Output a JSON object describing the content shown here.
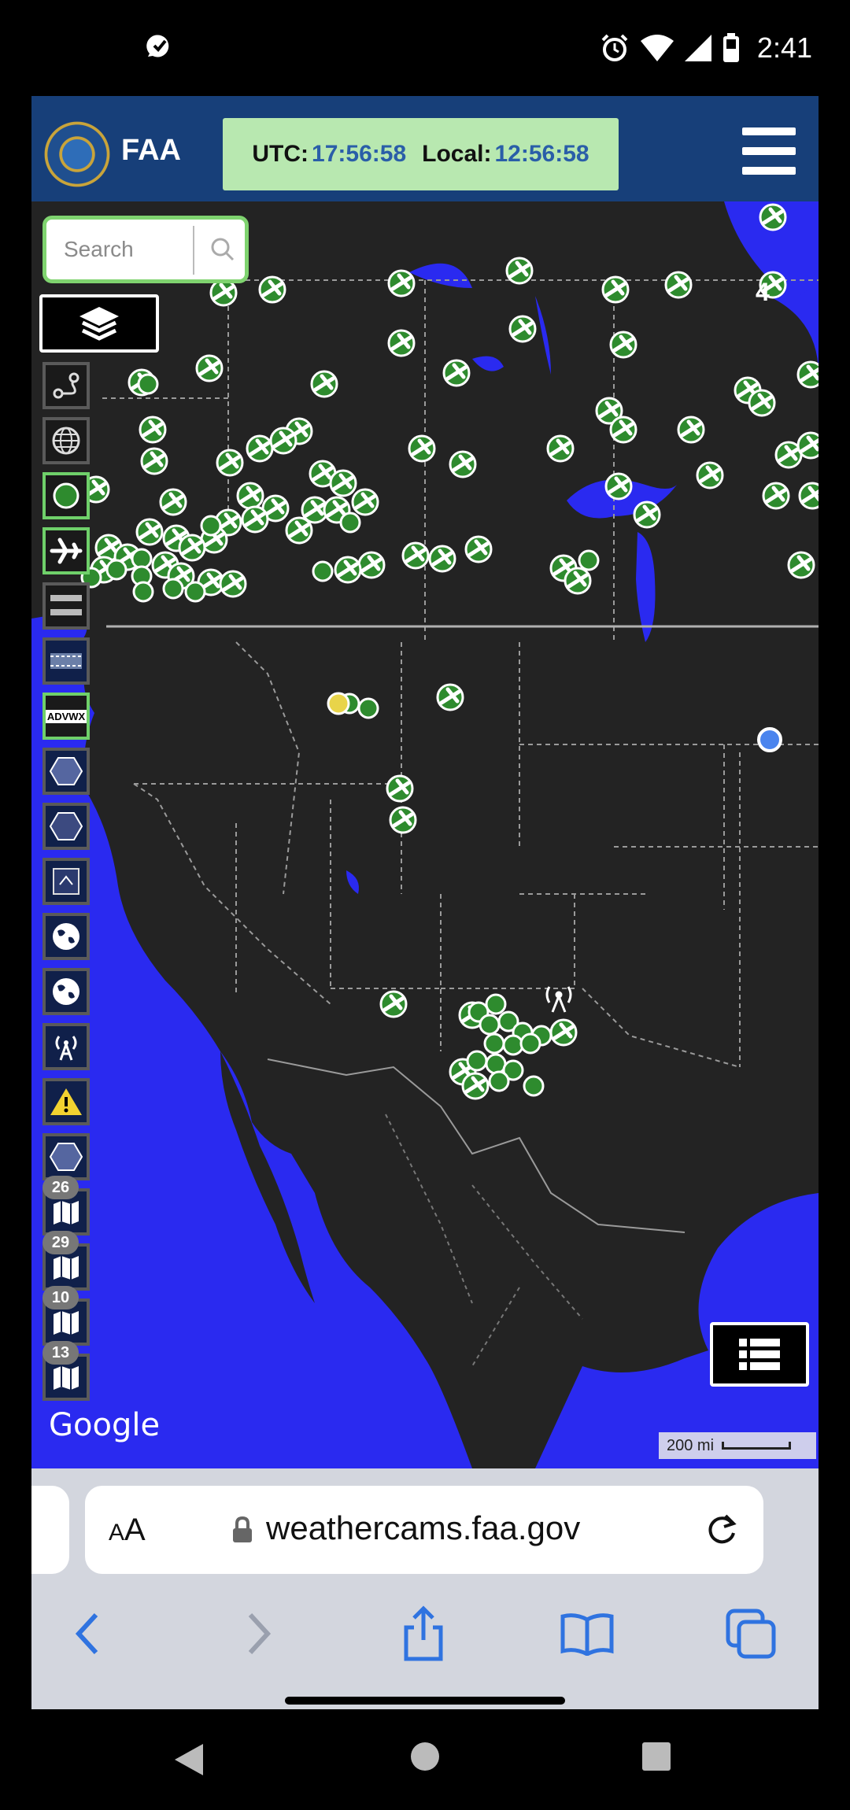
{
  "status_bar": {
    "time": "2:41"
  },
  "header": {
    "app_name": "FAA",
    "utc_label": "UTC:",
    "utc_time": "17:56:58",
    "local_label": "Local:",
    "local_time": "12:56:58"
  },
  "map": {
    "search_placeholder": "Search",
    "region_number": "4",
    "advwx_label": "ADVWX",
    "badges": [
      "26",
      "29",
      "10",
      "13"
    ],
    "attribution": "Google",
    "scale_label": "200 mi"
  },
  "browser": {
    "text_size_label_small": "A",
    "text_size_label_large": "A",
    "url": "weathercams.faa.gov"
  },
  "colors": {
    "header_bg": "#173f79",
    "clock_bg": "#b8e8b0",
    "water": "#2a2af0",
    "land": "#222222",
    "camera_green": "#2e8b2e",
    "accent_blue": "#2f73e0"
  }
}
